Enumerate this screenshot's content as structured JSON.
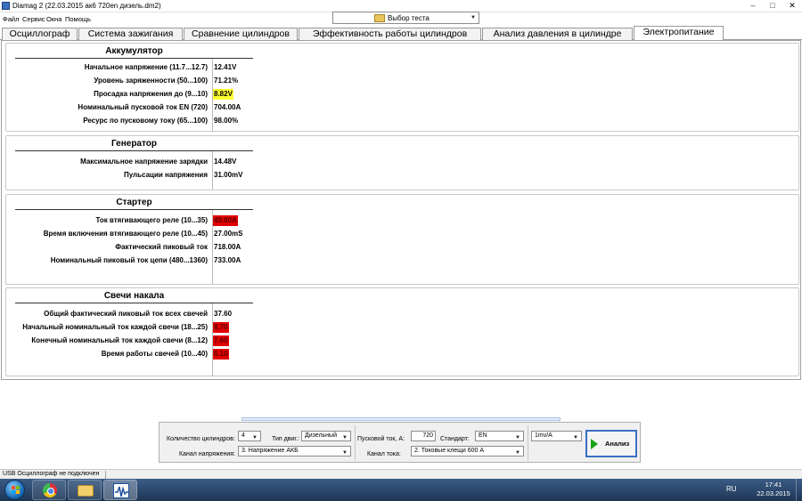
{
  "window": {
    "title": "Diamag 2 (22.03.2015  ак6 720en дизель.dm2)",
    "controls": {
      "minimize": "–",
      "maximize": "□",
      "close": "✕"
    }
  },
  "menu": [
    "Файл",
    "Сервис",
    "Окна",
    "Помощь"
  ],
  "test_select": {
    "label": "Выбор теста",
    "icon": "folder-icon"
  },
  "tabs": [
    {
      "label": "Осциллограф",
      "active": false
    },
    {
      "label": "Система зажигания",
      "active": false
    },
    {
      "label": "Сравнение цилиндров",
      "active": false
    },
    {
      "label": "Эффективность работы цилиндров",
      "active": false
    },
    {
      "label": "Анализ давления в цилиндре",
      "active": false
    },
    {
      "label": "Электропитание",
      "active": true
    }
  ],
  "sections": [
    {
      "title": "Аккумулятор",
      "rows": [
        {
          "label": "Начальное напряжение (11.7...12.7)",
          "value": "12.41V",
          "status": "normal"
        },
        {
          "label": "Уровень заряженности (50...100)",
          "value": "71.21%",
          "status": "normal"
        },
        {
          "label": "Просадка напряжения до (9...10)",
          "value": "8.82V",
          "status": "warning"
        },
        {
          "label": "Номинальный пусковой ток EN (720)",
          "value": "704.00A",
          "status": "normal"
        },
        {
          "label": "Ресурс по пусковому току (65...100)",
          "value": "98.00%",
          "status": "normal"
        }
      ]
    },
    {
      "title": "Генератор",
      "rows": [
        {
          "label": "Максимальное напряжение зарядки",
          "value": "14.48V",
          "status": "normal"
        },
        {
          "label": "Пульсации напряжения",
          "value": "31.00mV",
          "status": "normal"
        }
      ]
    },
    {
      "title": "Стартер",
      "rows": [
        {
          "label": "Ток втягивающего реле (10...35)",
          "value": "49.60A",
          "status": "error"
        },
        {
          "label": "Время включения втягивающего реле (10...45)",
          "value": "27.00mS",
          "status": "normal"
        },
        {
          "label": "Фактический пиковый ток",
          "value": "718.00A",
          "status": "normal"
        },
        {
          "label": "Номинальный пиковый ток цепи (480...1360)",
          "value": "733.00A",
          "status": "normal"
        }
      ]
    },
    {
      "title": "Свечи накала",
      "rows": [
        {
          "label": "Общий фактический пиковый ток всех свечей",
          "value": "37.60",
          "status": "normal"
        },
        {
          "label": "Начальный номинальный ток каждой свечи (18...25)",
          "value": "8.70",
          "status": "error"
        },
        {
          "label": "Конечный номинальный ток каждой свечи (8...12)",
          "value": "7.60",
          "status": "error"
        },
        {
          "label": "Время работы свечей (10...40)",
          "value": "5.10",
          "status": "error"
        }
      ]
    }
  ],
  "controls": {
    "cylinders_label": "Количество цилиндров:",
    "cylinders_value": "4",
    "engine_type_label": "Тип двиг.:",
    "engine_type_value": "Дизельный",
    "voltage_channel_label": "Канал напряжения:",
    "voltage_channel_value": "3. Напряжение АКБ",
    "start_current_label": "Пусковой ток, А:",
    "start_current_value": "720",
    "standard_label": "Стандарт:",
    "standard_value": "EN",
    "current_channel_label": "Канал тока:",
    "current_channel_value": "2. Токовые клещи 600 А",
    "scale_value": "1mv/A",
    "analyze_label": "Анализ"
  },
  "status_bar": {
    "usb": "USB Осциллограф не подключен"
  },
  "taskbar": {
    "lang": "RU",
    "time": "17:41",
    "date": "22.03.2015",
    "apps": [
      "chrome-icon",
      "explorer-icon",
      "diamag-icon"
    ]
  },
  "colors": {
    "warning": "#ffff33",
    "error": "#e00000",
    "accent": "#3a6fc4"
  }
}
